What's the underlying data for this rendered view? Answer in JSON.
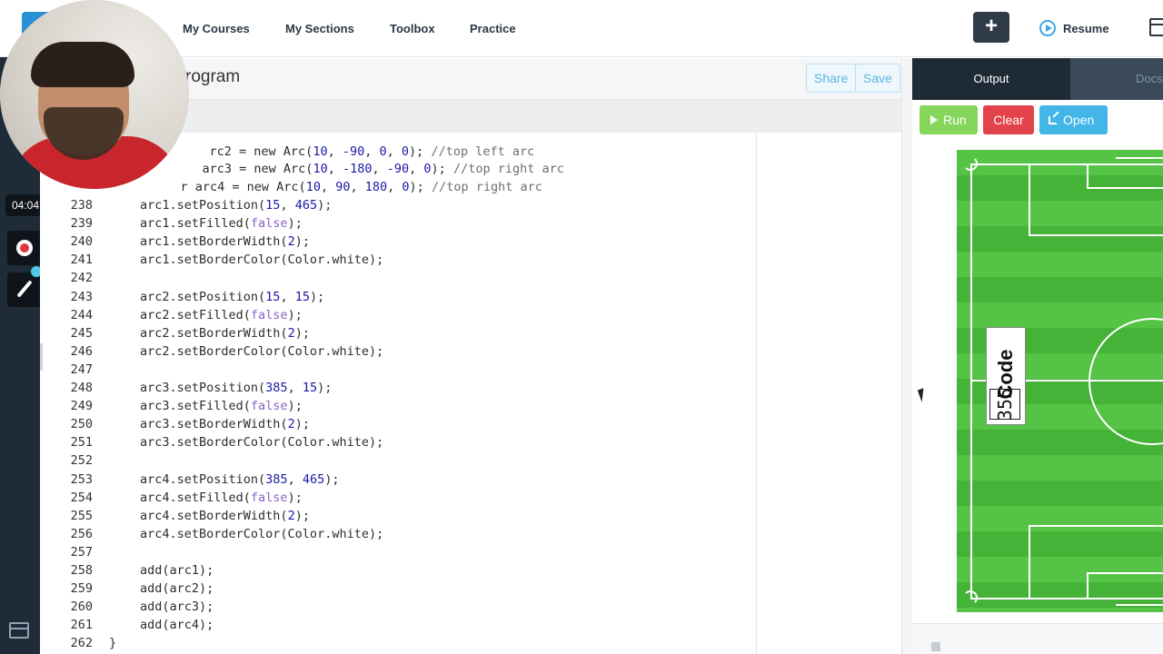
{
  "nav": {
    "links": [
      "My Courses",
      "My Sections",
      "Toolbox",
      "Practice"
    ],
    "plus": "+",
    "resume": "Resume"
  },
  "recorder": {
    "timer": "04:04"
  },
  "editor": {
    "title": "rogram",
    "share": "Share",
    "save": "Save",
    "top_fragments": [
      "rc2 = new Arc(10, -90, 0, 0); //top left arc",
      "arc3 = new Arc(10, -180, -90, 0); //top right arc",
      "r arc4 = new Arc(10, 90, 180, 0); //top right arc"
    ],
    "lines": [
      {
        "n": "238",
        "code": "arc1.setPosition(15, 465);"
      },
      {
        "n": "239",
        "code": "arc1.setFilled(false);"
      },
      {
        "n": "240",
        "code": "arc1.setBorderWidth(2);"
      },
      {
        "n": "241",
        "code": "arc1.setBorderColor(Color.white);"
      },
      {
        "n": "242",
        "code": ""
      },
      {
        "n": "243",
        "code": "arc2.setPosition(15, 15);"
      },
      {
        "n": "244",
        "code": "arc2.setFilled(false);"
      },
      {
        "n": "245",
        "code": "arc2.setBorderWidth(2);"
      },
      {
        "n": "246",
        "code": "arc2.setBorderColor(Color.white);"
      },
      {
        "n": "247",
        "code": ""
      },
      {
        "n": "248",
        "code": "arc3.setPosition(385, 15);"
      },
      {
        "n": "249",
        "code": "arc3.setFilled(false);"
      },
      {
        "n": "250",
        "code": "arc3.setBorderWidth(2);"
      },
      {
        "n": "251",
        "code": "arc3.setBorderColor(Color.white);"
      },
      {
        "n": "252",
        "code": ""
      },
      {
        "n": "253",
        "code": "arc4.setPosition(385, 465);"
      },
      {
        "n": "254",
        "code": "arc4.setFilled(false);"
      },
      {
        "n": "255",
        "code": "arc4.setBorderWidth(2);"
      },
      {
        "n": "256",
        "code": "arc4.setBorderColor(Color.white);"
      },
      {
        "n": "257",
        "code": ""
      },
      {
        "n": "258",
        "code": "add(arc1);"
      },
      {
        "n": "259",
        "code": "add(arc2);"
      },
      {
        "n": "260",
        "code": "add(arc3);"
      },
      {
        "n": "261",
        "code": "add(arc4);"
      },
      {
        "n": "262",
        "code": "}"
      }
    ]
  },
  "output": {
    "tabs": [
      "Output",
      "Docs"
    ],
    "run": "Run",
    "clear": "Clear",
    "open": "Open",
    "badge_title": "Code",
    "badge_number": "355"
  },
  "colors": {
    "field_light": "#55c346",
    "field_dark": "#45b338",
    "run": "#86d65b",
    "clear": "#e2424a",
    "open": "#43b5e6",
    "sidebar": "#1f2b36"
  },
  "icons": [
    "logo-icon",
    "plus-icon",
    "play-circle-icon",
    "layout-icon",
    "record-icon",
    "pen-icon",
    "grid-icon",
    "external-link-icon",
    "mouse-cursor-icon"
  ]
}
